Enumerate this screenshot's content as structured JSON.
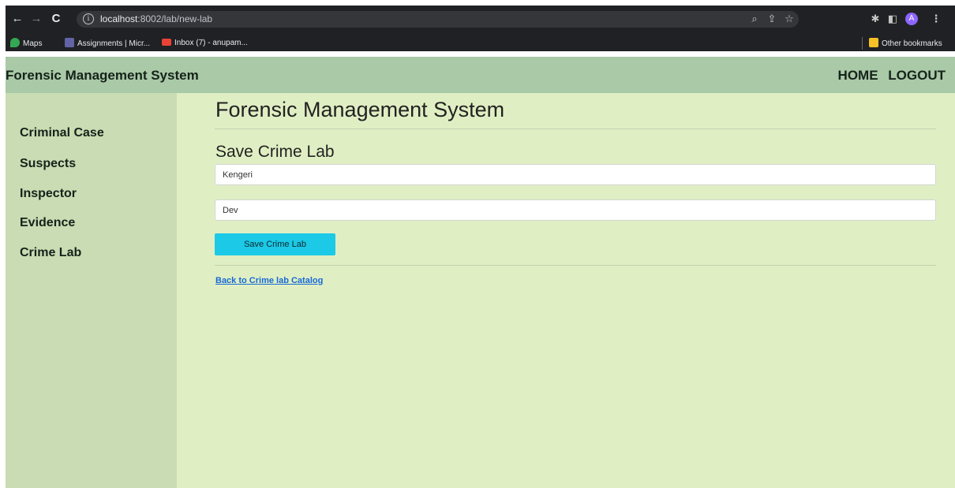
{
  "browser": {
    "url_host": "localhost",
    "url_path": ":8002/lab/new-lab",
    "avatar_initial": "A",
    "bookmarks": [
      {
        "label": "Maps",
        "icon": "maps-pin-icon"
      },
      {
        "label": "Assignments | Micr...",
        "icon": "teams-icon"
      },
      {
        "label": "Inbox (7) - anupam...",
        "icon": "gmail-icon"
      }
    ],
    "other_bookmarks": "Other bookmarks"
  },
  "header": {
    "brand": "Forensic Management System",
    "nav": [
      "HOME",
      "LOGOUT"
    ]
  },
  "sidebar": {
    "items": [
      "Criminal Case",
      "Suspects",
      "Inspector",
      "Evidence",
      "Crime Lab"
    ]
  },
  "main": {
    "title": "Forensic Management System",
    "subtitle": "Save Crime Lab",
    "fields": [
      {
        "value": "Kengeri"
      },
      {
        "value": "Dev"
      }
    ],
    "save_button": "Save Crime Lab",
    "back_link": "Back to Crime lab Catalog"
  },
  "colors": {
    "header_bg": "#a9c9a7",
    "sidebar_bg": "#c9dcb3",
    "main_bg": "#e0efc3",
    "button_bg": "#1cc9e6",
    "link": "#1769d6"
  }
}
